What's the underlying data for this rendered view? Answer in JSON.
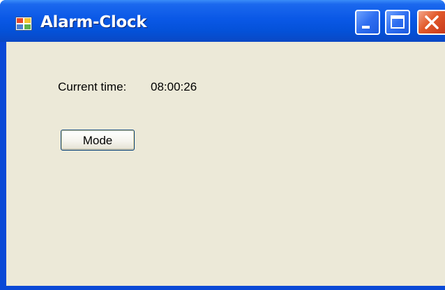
{
  "window": {
    "title": "Alarm-Clock",
    "icon": "application-icon",
    "controls": [
      "minimize-icon",
      "maximize-icon",
      "close-icon"
    ]
  },
  "content": {
    "time_label": "Current time:",
    "time_value": "08:00:26",
    "mode_button": "Mode"
  },
  "colors": {
    "titlebar": "#0a58e6",
    "client_background": "#ece9d8",
    "close_button": "#e25a2a"
  }
}
